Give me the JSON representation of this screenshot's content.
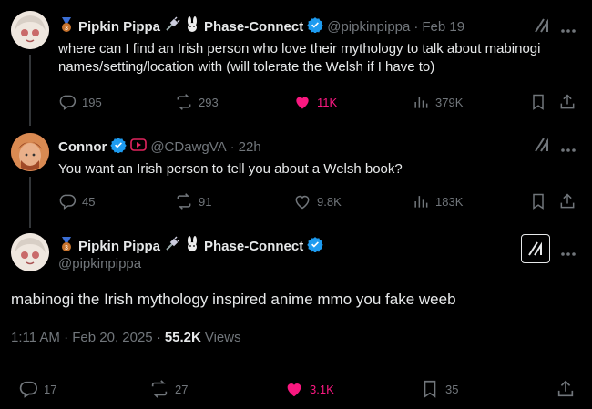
{
  "colors": {
    "bg": "#000000",
    "text": "#e7e9ea",
    "muted": "#71767b",
    "like": "#f91880",
    "verified": "#1d9bf0",
    "divider": "#2f3336"
  },
  "tweet1": {
    "name": "Pipkin Pippa",
    "badges": "Phase-Connect",
    "handle": "@pipkinpippa",
    "dot": "·",
    "date": "Feb 19",
    "text": "where can I find an Irish person who love their mythology to talk about mabinogi names/setting/location with (will tolerate the Welsh if I have to)",
    "replies": "195",
    "reposts": "293",
    "likes": "11K",
    "views": "379K"
  },
  "tweet2": {
    "name": "Connor",
    "handle": "@CDawgVA",
    "dot": "·",
    "date": "22h",
    "text": "You want an Irish person to tell you about a Welsh book?",
    "replies": "45",
    "reposts": "91",
    "likes": "9.8K",
    "views": "183K"
  },
  "tweet3": {
    "name": "Pipkin Pippa",
    "badges": "Phase-Connect",
    "handle": "@pipkinpippa",
    "text": "mabinogi the Irish mythology inspired anime mmo you fake weeb",
    "time": "1:11 AM · Feb 20, 2025 ·",
    "views_count": "55.2K",
    "views_label": "Views",
    "replies": "17",
    "reposts": "27",
    "likes": "3.1K",
    "bookmarks": "35"
  }
}
